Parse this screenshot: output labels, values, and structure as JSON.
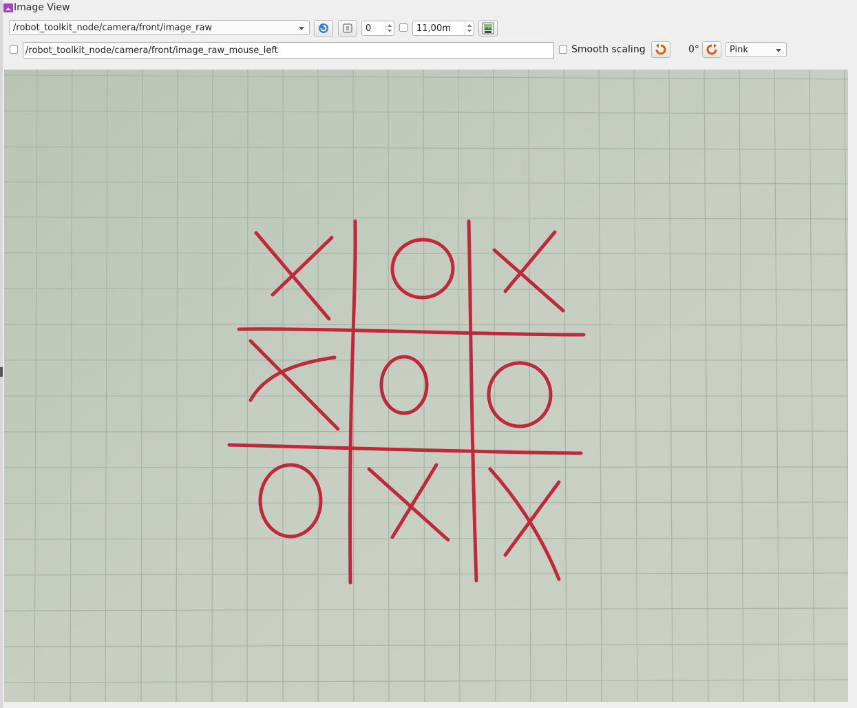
{
  "window": {
    "title": "Image View"
  },
  "toolbar1": {
    "topic": "/robot_toolkit_node/camera/front/image_raw",
    "refresh_icon": "refresh-icon",
    "zoom_fit_icon": "zoom-fit-icon",
    "number_value": "0",
    "max_value": "11,00m",
    "save_icon": "save-image-icon"
  },
  "toolbar2": {
    "mouse_topic": "/robot_toolkit_node/camera/front/image_raw_mouse_left",
    "smooth_scaling_label": "Smooth scaling",
    "smooth_scaling_checked": false,
    "rotate_ccw_icon": "rotate-ccw-icon",
    "rotation": "0°",
    "rotate_cw_icon": "rotate-cw-icon",
    "colormap": "Pink"
  },
  "image": {
    "description_icon": "camera-image",
    "board_color": "#c0182e",
    "background_color": "#c3ccbf"
  }
}
